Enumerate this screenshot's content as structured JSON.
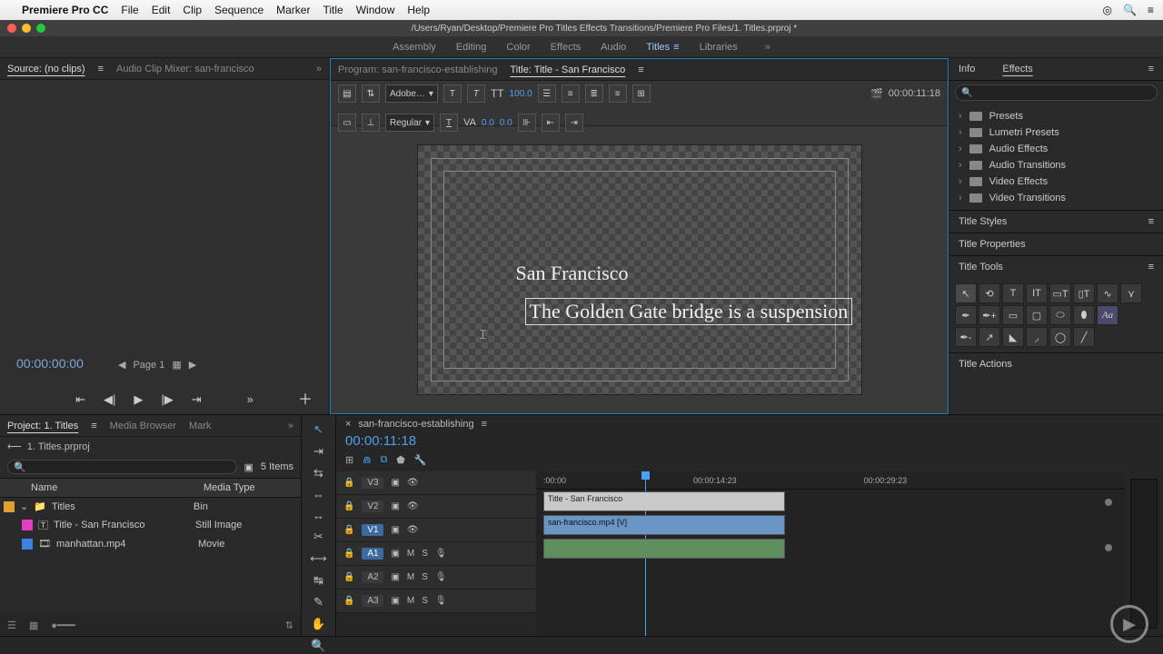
{
  "mac_menu": {
    "app": "Premiere Pro CC",
    "items": [
      "File",
      "Edit",
      "Clip",
      "Sequence",
      "Marker",
      "Title",
      "Window",
      "Help"
    ]
  },
  "window_path": "/Users/Ryan/Desktop/Premiere Pro Titles Effects Transitions/Premiere Pro Files/1. Titles.prproj *",
  "workspaces": [
    "Assembly",
    "Editing",
    "Color",
    "Effects",
    "Audio",
    "Titles",
    "Libraries"
  ],
  "workspace_active": 5,
  "source": {
    "tabs": [
      "Source: (no clips)",
      "Audio Clip Mixer: san-francisco"
    ],
    "timecode": "00:00:00:00",
    "page": "Page 1"
  },
  "program": {
    "tabs": [
      "Program: san-francisco-establishing",
      "Title: Title - San Francisco"
    ],
    "font_family": "Adobe…",
    "font_style": "Regular",
    "font_size": "100.0",
    "kerning": "0.0",
    "tracking": "0.0",
    "timecode": "00:00:11:18",
    "title_line1": "San Francisco",
    "title_line2": "The Golden Gate bridge is a suspension"
  },
  "right": {
    "tabs": [
      "Info",
      "Effects"
    ],
    "folders": [
      "Presets",
      "Lumetri Presets",
      "Audio Effects",
      "Audio Transitions",
      "Video Effects",
      "Video Transitions"
    ],
    "sections": [
      "Title Styles",
      "Title Properties",
      "Title Tools",
      "Title Actions"
    ]
  },
  "project": {
    "tabs": [
      "Project: 1. Titles",
      "Media Browser",
      "Mark"
    ],
    "file": "1. Titles.prproj",
    "item_count": "5 Items",
    "columns": [
      "Name",
      "Media Type"
    ],
    "rows": [
      {
        "color": "#e0a030",
        "name": "Titles",
        "type": "Bin",
        "indent": 1,
        "icon": "folder"
      },
      {
        "color": "#e040c0",
        "name": "Title - San Francisco",
        "type": "Still Image",
        "indent": 2,
        "icon": "title"
      },
      {
        "color": "#4080e0",
        "name": "manhattan.mp4",
        "type": "Movie",
        "indent": 2,
        "icon": "movie"
      }
    ]
  },
  "timeline": {
    "sequence": "san-francisco-establishing",
    "timecode": "00:00:11:18",
    "ruler": [
      ":00:00",
      "00:00:14:23",
      "00:00:29:23"
    ],
    "tracks": [
      {
        "id": "V3",
        "active": false
      },
      {
        "id": "V2",
        "active": false
      },
      {
        "id": "V1",
        "active": true
      },
      {
        "id": "A1",
        "active": true
      },
      {
        "id": "A2",
        "active": false
      },
      {
        "id": "A3",
        "active": false
      }
    ],
    "clip_title": "Title - San Francisco",
    "clip_video": "san-francisco.mp4 [V]"
  }
}
